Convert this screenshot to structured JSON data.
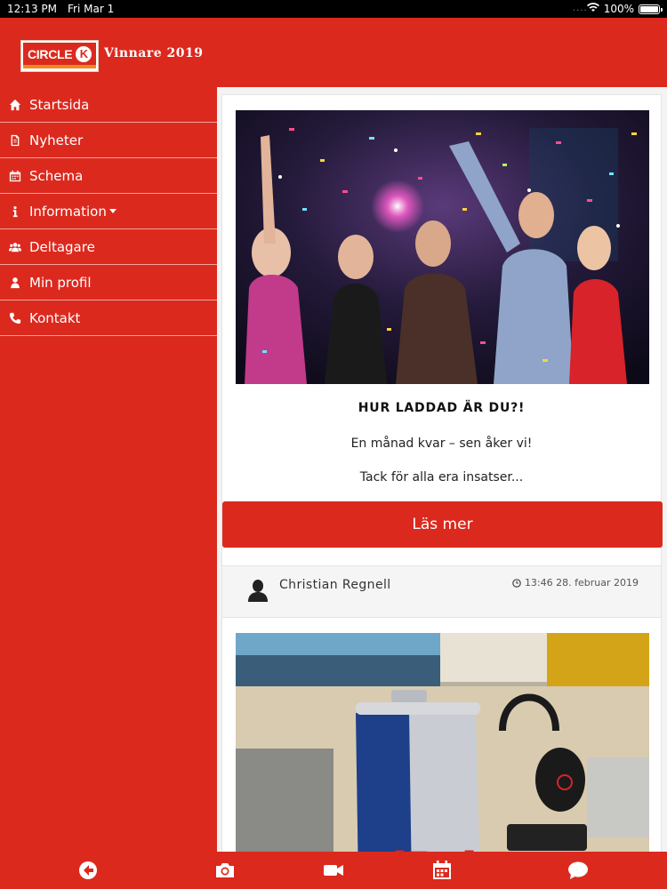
{
  "statusbar": {
    "time": "12:13 PM",
    "date": "Fri Mar 1",
    "dots": "....",
    "battery": "100%",
    "battery_level": 1.0
  },
  "header": {
    "logo_text": "CIRCLE",
    "logo_k": "K",
    "title": "Vinnare 2019"
  },
  "sidebar": {
    "items": [
      {
        "label": "Startsida",
        "icon": "home-icon"
      },
      {
        "label": "Nyheter",
        "icon": "document-icon"
      },
      {
        "label": "Schema",
        "icon": "calendar-icon"
      },
      {
        "label": "Information",
        "icon": "info-icon"
      },
      {
        "label": "Deltagare",
        "icon": "users-icon"
      },
      {
        "label": "Min profil",
        "icon": "user-icon"
      },
      {
        "label": "Kontakt",
        "icon": "phone-icon"
      }
    ]
  },
  "post1": {
    "image": "party-photo",
    "title": "HUR LADDAD ÄR DU?!",
    "line1": "En månad kvar – sen åker vi!",
    "line2": "Tack för alla era insatser...",
    "button": "Läs mer"
  },
  "post2": {
    "author": "Christian Regnell",
    "timestamp": "13:46 28. februar 2019",
    "image": "energy-drink-photo"
  },
  "bottombar": {
    "icons": [
      "back-arrow-icon",
      "camera-icon",
      "video-icon",
      "calendar-icon",
      "chat-icon"
    ]
  },
  "colors": {
    "brand_red": "#dc291e",
    "accent_orange": "#f08a1e"
  }
}
